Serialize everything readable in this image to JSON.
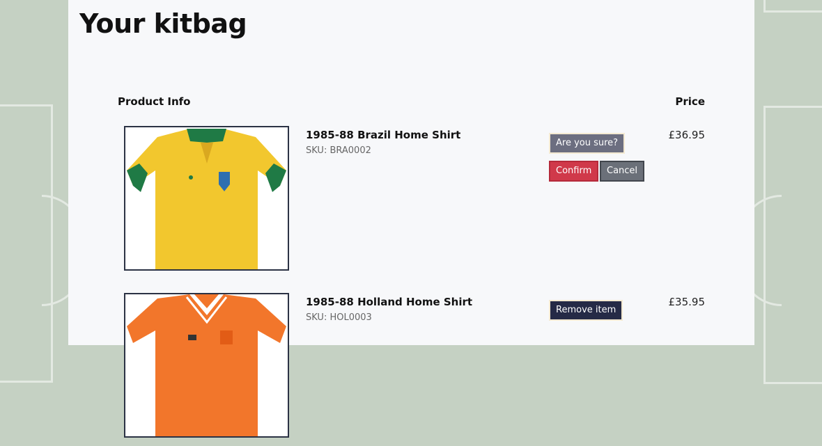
{
  "page": {
    "title": "Your kitbag"
  },
  "table": {
    "product_header": "Product Info",
    "price_header": "Price"
  },
  "items": [
    {
      "name": "1985-88 Brazil Home Shirt",
      "sku": "SKU: BRA0002",
      "price": "£36.95",
      "image_icon": "yellow-football-shirt-icon",
      "actions": {
        "confirm_prompt": "Are you sure?",
        "confirm_label": "Confirm",
        "cancel_label": "Cancel"
      }
    },
    {
      "name": "1985-88 Holland Home Shirt",
      "sku": "SKU: HOL0003",
      "price": "£35.95",
      "image_icon": "orange-football-shirt-icon",
      "actions": {
        "remove_label": "Remove item"
      }
    }
  ],
  "colors": {
    "brazil_shirt": "#f2c72e",
    "brazil_trim": "#1f7a45",
    "holland_shirt": "#f2762b",
    "confirm": "#d0394a",
    "remove": "#252a46"
  }
}
